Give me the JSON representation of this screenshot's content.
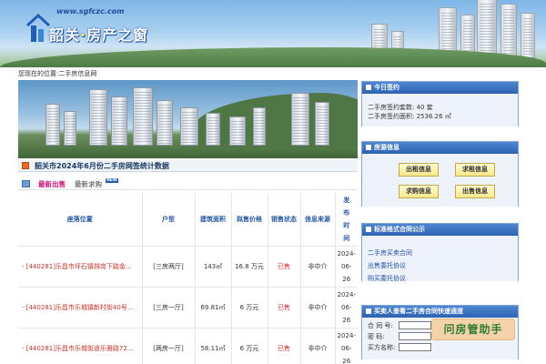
{
  "banner": {
    "site_url": "www.sgfczc.com",
    "title_part1": "韶关",
    "title_dot": "·",
    "title_part2": "房产之窗"
  },
  "breadcrumb": "您现在的位置:二手房信息网",
  "stats": {
    "title": "韶关市2024年6月份二手房网签统计数据"
  },
  "tabs": {
    "active": "最新出售",
    "other": "最新求购",
    "badge": "NEW"
  },
  "table": {
    "headers": {
      "location": "座落位置",
      "layout": "户型",
      "area": "建筑面积",
      "price": "拟售价格",
      "status": "销售状态",
      "source": "信息来源",
      "published": [
        "发",
        "布",
        "时",
        "间"
      ]
    },
    "rows": [
      {
        "location": "- [440281]乐昌市坪石镇排岗下路金...",
        "layout": "[三房两厅]",
        "area": "143㎡",
        "price": "16.8 万元",
        "status": "已售",
        "source": "非中介",
        "published": [
          "2024-",
          "06-",
          "26"
        ]
      },
      {
        "location": "- [440281]乐昌市乐城镇新村街40号...",
        "layout": "[三房一厅]",
        "area": "69.81㎡",
        "price": "6 万元",
        "status": "已售",
        "source": "非中介",
        "published": [
          "2024-",
          "06-",
          "26"
        ]
      },
      {
        "location": "- [440281]乐昌市乐城街道乐雅路72...",
        "layout": "[两房一厅]",
        "area": "58.11㎡",
        "price": "6 万元",
        "status": "已售",
        "source": "非中介",
        "published": [
          "2024-",
          "06-",
          "26"
        ]
      }
    ]
  },
  "panels": {
    "today": {
      "title": "今日签约",
      "count_line": "二手房签约套数: 40 套",
      "area_line": "二手房签约面积: 2536.26 ㎡"
    },
    "listings": {
      "title": "房源信息",
      "buttons": [
        "出租信息",
        "求租信息",
        "求购信息",
        "出售信息"
      ]
    },
    "contracts": {
      "title": "标准格式合同公示",
      "links": [
        "二手房买卖合同",
        "出售委托协议",
        "购买委托协议"
      ]
    },
    "query": {
      "title": "买卖人查看二手房合同快速通道",
      "contract_no_label": "合 同 号:",
      "password_label": "密    码:",
      "buyer_label": "买方名称:"
    }
  },
  "watermark": "问房管助手",
  "colors": {
    "panel_header": "#2c62b3",
    "accent_red": "#e0272c",
    "tab_active": "#d6127a"
  }
}
